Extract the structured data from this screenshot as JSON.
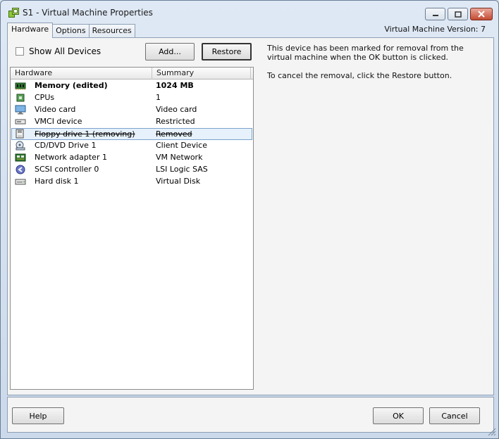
{
  "window": {
    "title": "S1 - Virtual Machine Properties",
    "vm_version": "Virtual Machine Version: 7"
  },
  "tabs": [
    {
      "label": "Hardware",
      "active": true
    },
    {
      "label": "Options",
      "active": false
    },
    {
      "label": "Resources",
      "active": false
    }
  ],
  "toolbar": {
    "show_all_devices_label": "Show All Devices",
    "show_all_devices_checked": false,
    "add_label": "Add...",
    "restore_label": "Restore"
  },
  "hardware_list": {
    "columns": [
      "Hardware",
      "Summary"
    ],
    "rows": [
      {
        "name": "Memory (edited)",
        "summary": "1024 MB",
        "icon": "memory-icon",
        "style": "bold"
      },
      {
        "name": "CPUs",
        "summary": "1",
        "icon": "cpu-icon",
        "style": "normal"
      },
      {
        "name": "Video card",
        "summary": "Video card",
        "icon": "monitor-icon",
        "style": "normal"
      },
      {
        "name": "VMCI device",
        "summary": "Restricted",
        "icon": "vmci-device-icon",
        "style": "normal"
      },
      {
        "name": "Floppy drive 1 (removing)",
        "summary": "Removed",
        "icon": "floppy-drive-icon",
        "style": "removed",
        "selected": true
      },
      {
        "name": "CD/DVD Drive 1",
        "summary": "Client Device",
        "icon": "cd-dvd-icon",
        "style": "normal"
      },
      {
        "name": "Network adapter 1",
        "summary": "VM Network",
        "icon": "network-adapter-icon",
        "style": "normal"
      },
      {
        "name": "SCSI controller 0",
        "summary": "LSI Logic SAS",
        "icon": "scsi-controller-icon",
        "style": "normal"
      },
      {
        "name": "Hard disk 1",
        "summary": "Virtual Disk",
        "icon": "hard-disk-icon",
        "style": "normal"
      }
    ]
  },
  "info_panel": {
    "line1": "This device has been marked for removal from the virtual machine when the OK button is clicked.",
    "line2": "To cancel the removal, click the Restore button."
  },
  "footer": {
    "help_label": "Help",
    "ok_label": "OK",
    "cancel_label": "Cancel"
  }
}
